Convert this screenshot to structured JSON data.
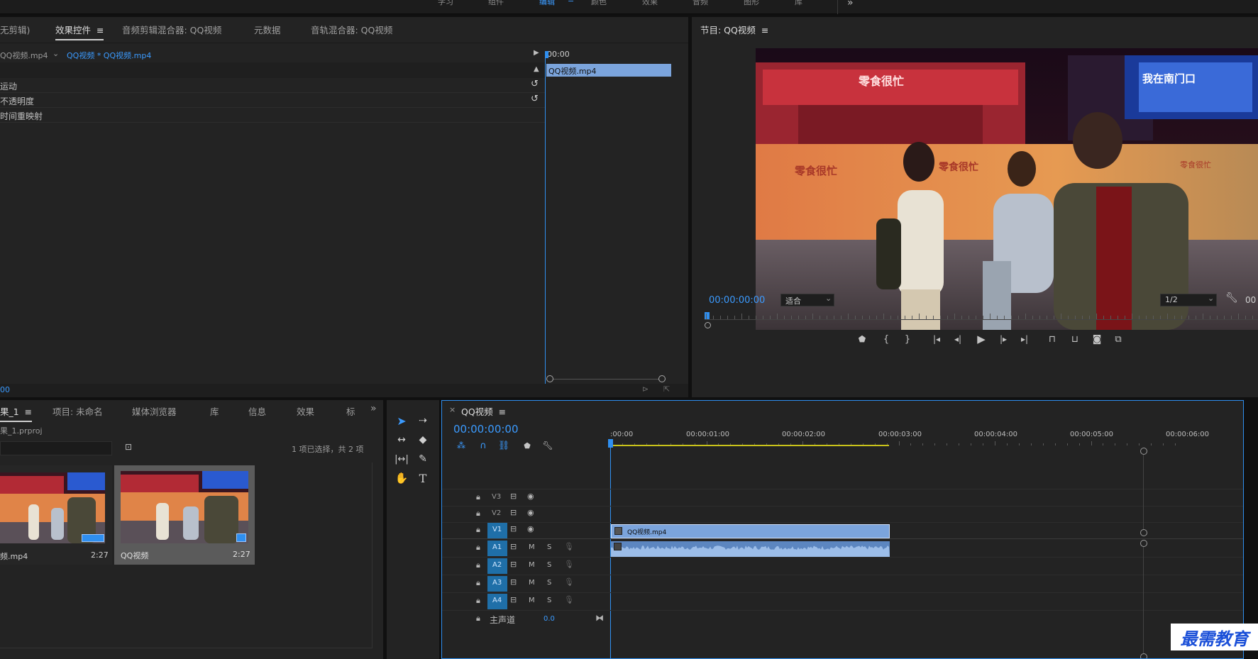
{
  "workspace_tabs": [
    "学习",
    "组件",
    "编辑",
    "颜色",
    "效果",
    "音频",
    "图形",
    "库"
  ],
  "workspace_active": "编辑",
  "workspace_more": "»",
  "source_panel": {
    "tabs": [
      "无剪辑)",
      "效果控件",
      "音频剪辑混合器: QQ视频",
      "元数据",
      "音轨混合器: QQ视频"
    ],
    "active_tab": "效果控件",
    "menu_icon": "≡",
    "master_clip": "QQ视频.mp4",
    "sequence_clip": "QQ视频 * QQ视频.mp4",
    "effects": [
      "运动",
      "不透明度",
      "时间重映射"
    ],
    "mini_timecode": "00:00",
    "mini_clip_label": "QQ视频.mp4",
    "bottom_timecode": "00"
  },
  "program_monitor": {
    "title": "节目: QQ视频",
    "menu_icon": "≡",
    "timecode": "00:00:00:00",
    "zoom": "适合",
    "resolution": "1/2",
    "right_timecode": "00",
    "video_signs": [
      "零食很忙",
      "零食很忙",
      "零食很忙",
      "我在南门口",
      "零食很忙"
    ]
  },
  "project_panel": {
    "tabs": [
      "果_1",
      "项目: 未命名",
      "媒体浏览器",
      "库",
      "信息",
      "效果",
      "标"
    ],
    "active_tab": "果_1",
    "more": "»",
    "file_name": "果_1.prproj",
    "selection_info": "1 项已选择，共 2 项",
    "items": [
      {
        "name": "频.mp4",
        "duration": "2:27"
      },
      {
        "name": "QQ视频",
        "duration": "2:27"
      }
    ]
  },
  "tools": [
    "selection-tool",
    "track-select-tool",
    "ripple-edit-tool",
    "razor-tool",
    "slip-tool",
    "pen-tool",
    "hand-tool",
    "type-tool"
  ],
  "timeline": {
    "close": "×",
    "sequence_name": "QQ视频",
    "menu_icon": "≡",
    "timecode": "00:00:00:00",
    "ruler_labels": [
      ":00:00",
      "00:00:01:00",
      "00:00:02:00",
      "00:00:03:00",
      "00:00:04:00",
      "00:00:05:00",
      "00:00:06:00"
    ],
    "video_tracks": [
      "V3",
      "V2",
      "V1"
    ],
    "audio_tracks": [
      "A1",
      "A2",
      "A3",
      "A4"
    ],
    "mute_label": "M",
    "solo_label": "S",
    "master_track": "主声道",
    "master_value": "0.0",
    "clip_label": "QQ视频.mp4",
    "clip_duration_seconds": 2.9
  },
  "watermark": "最需教育",
  "colors": {
    "accent_blue": "#2f8ff0",
    "clip_blue": "#7ba4dc",
    "track_blue": "#1f6fa8",
    "work_area_yellow": "#c9c21a"
  }
}
